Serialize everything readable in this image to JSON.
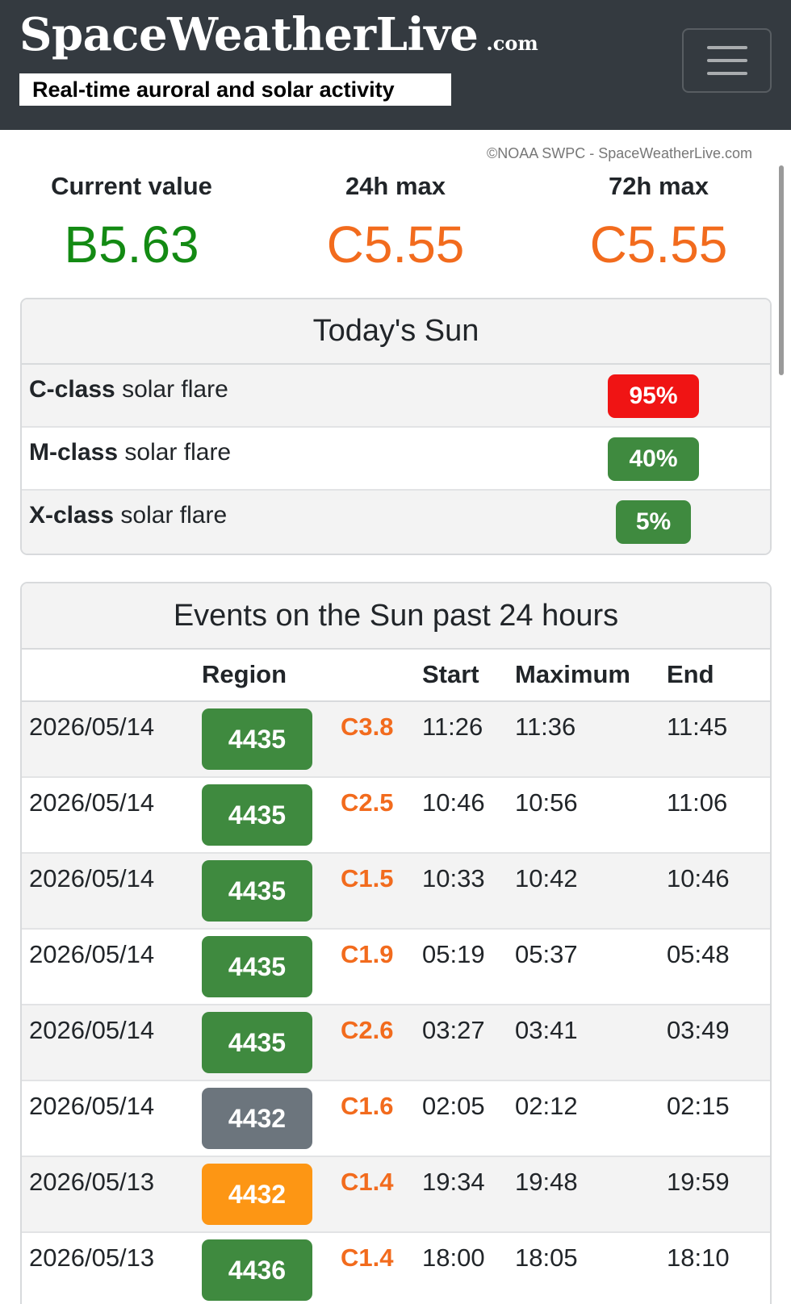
{
  "header": {
    "brand_name": "SpaceWeatherLive",
    "brand_tld": ".com",
    "tagline": "Real-time auroral and solar activity",
    "menu_icon": "hamburger-menu-icon"
  },
  "credit": "©NOAA SWPC - SpaceWeatherLive.com",
  "xray": {
    "current": {
      "label": "Current value",
      "value": "B5.63",
      "color": "#138a13"
    },
    "max24": {
      "label": "24h max",
      "value": "C5.55",
      "color": "#f26b1d"
    },
    "max72": {
      "label": "72h max",
      "value": "C5.55",
      "color": "#f26b1d"
    }
  },
  "todays_sun": {
    "title": "Today's Sun",
    "rows": [
      {
        "class_label": "C-class",
        "suffix": " solar flare",
        "probability": "95%",
        "color": "#f01414"
      },
      {
        "class_label": "M-class",
        "suffix": " solar flare",
        "probability": "40%",
        "color": "#3f8a3f"
      },
      {
        "class_label": "X-class",
        "suffix": " solar flare",
        "probability": "5%",
        "color": "#3f8a3f"
      }
    ]
  },
  "events": {
    "title": "Events on the Sun past 24 hours",
    "columns": {
      "date": "",
      "region": "Region",
      "class": "",
      "start": "Start",
      "maximum": "Maximum",
      "end": "End"
    },
    "rows": [
      {
        "date": "2026/05/14",
        "region": "4435",
        "region_color": "green",
        "class": "C3.8",
        "start": "11:26",
        "maximum": "11:36",
        "end": "11:45"
      },
      {
        "date": "2026/05/14",
        "region": "4435",
        "region_color": "green",
        "class": "C2.5",
        "start": "10:46",
        "maximum": "10:56",
        "end": "11:06"
      },
      {
        "date": "2026/05/14",
        "region": "4435",
        "region_color": "green",
        "class": "C1.5",
        "start": "10:33",
        "maximum": "10:42",
        "end": "10:46"
      },
      {
        "date": "2026/05/14",
        "region": "4435",
        "region_color": "green",
        "class": "C1.9",
        "start": "05:19",
        "maximum": "05:37",
        "end": "05:48"
      },
      {
        "date": "2026/05/14",
        "region": "4435",
        "region_color": "green",
        "class": "C2.6",
        "start": "03:27",
        "maximum": "03:41",
        "end": "03:49"
      },
      {
        "date": "2026/05/14",
        "region": "4432",
        "region_color": "gray",
        "class": "C1.6",
        "start": "02:05",
        "maximum": "02:12",
        "end": "02:15"
      },
      {
        "date": "2026/05/13",
        "region": "4432",
        "region_color": "orange",
        "class": "C1.4",
        "start": "19:34",
        "maximum": "19:48",
        "end": "19:59"
      },
      {
        "date": "2026/05/13",
        "region": "4436",
        "region_color": "green",
        "class": "C1.4",
        "start": "18:00",
        "maximum": "18:05",
        "end": "18:10"
      }
    ]
  }
}
